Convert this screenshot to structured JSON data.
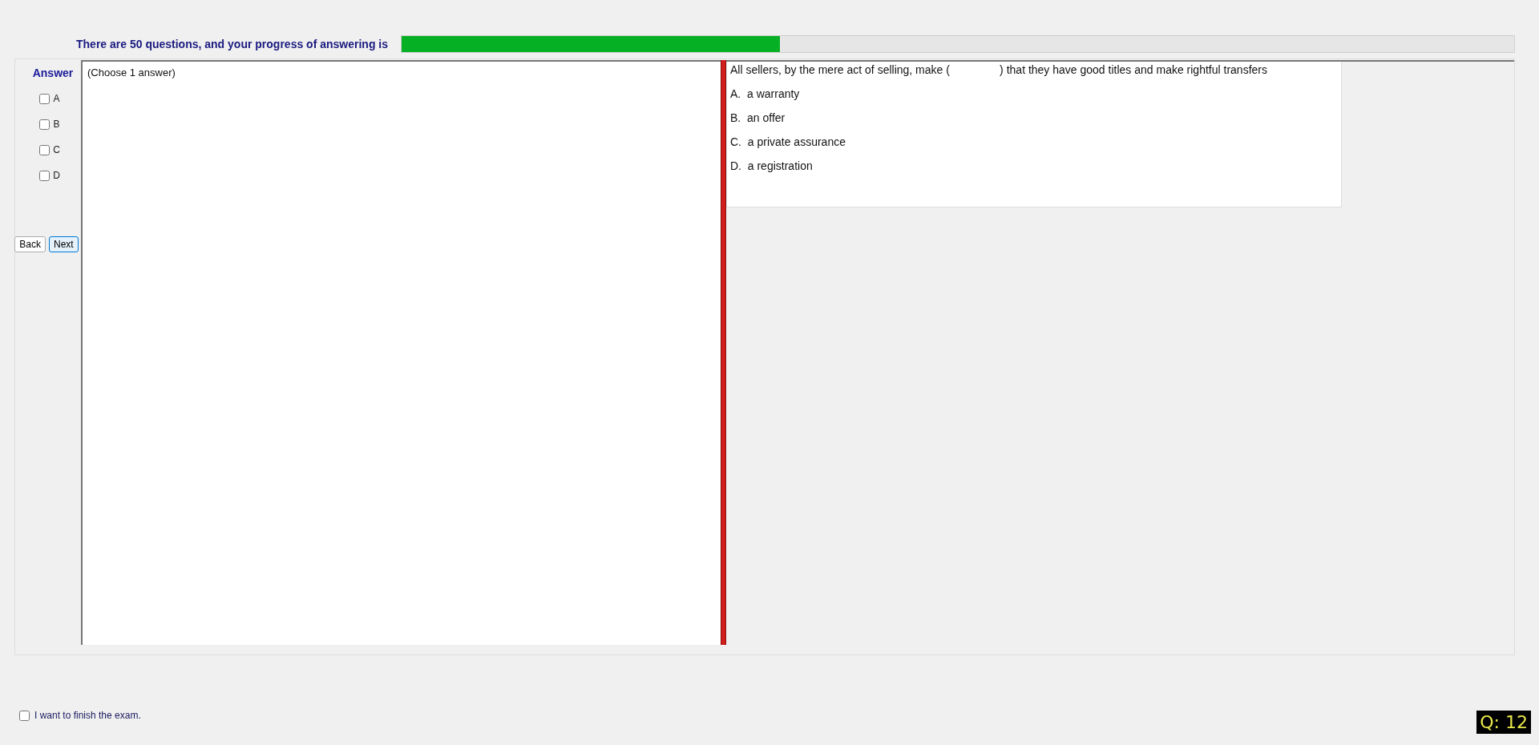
{
  "progress": {
    "label": "There are 50 questions, and your progress of answering is",
    "level": 0.34
  },
  "answer": {
    "title": "Answer",
    "options": [
      {
        "label": "A",
        "checked": false
      },
      {
        "label": "B",
        "checked": false
      },
      {
        "label": "C",
        "checked": false
      },
      {
        "label": "D",
        "checked": false
      }
    ]
  },
  "nav_buttons": [
    {
      "label": "Back",
      "selected": false
    },
    {
      "label": "Next",
      "selected": true
    }
  ],
  "instruction": "(Choose 1 answer)",
  "question": {
    "text": "All sellers, by the mere act of selling, make (                ) that they have good titles and make rightful transfers",
    "choices": [
      {
        "letter": "A.",
        "text": "a warranty"
      },
      {
        "letter": "B.",
        "text": "an offer"
      },
      {
        "letter": "C.",
        "text": "a private assurance"
      },
      {
        "letter": "D.",
        "text": "a registration"
      }
    ]
  },
  "finish": {
    "label": "I want to finish the exam.",
    "checked": false
  },
  "question_counter": "Q: 12"
}
